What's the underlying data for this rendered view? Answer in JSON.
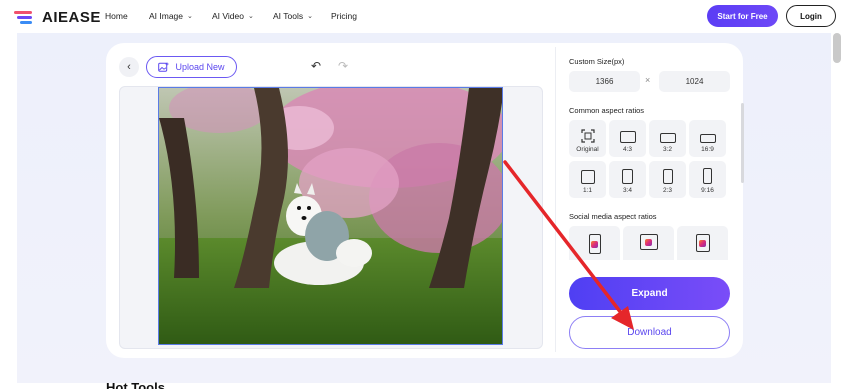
{
  "header": {
    "logo_text": "AIEASE",
    "nav": [
      {
        "label": "Home",
        "has_dropdown": false
      },
      {
        "label": "AI Image",
        "has_dropdown": true
      },
      {
        "label": "AI Video",
        "has_dropdown": true
      },
      {
        "label": "AI Tools",
        "has_dropdown": true
      },
      {
        "label": "Pricing",
        "has_dropdown": false
      }
    ],
    "start_button": "Start for Free",
    "login_button": "Login"
  },
  "editor": {
    "upload_label": "Upload New",
    "icons": {
      "back": "chevron-left-icon",
      "upload": "image-upload-icon",
      "undo": "undo-icon",
      "redo": "redo-icon"
    }
  },
  "panel": {
    "custom_size_label": "Custom Size(px)",
    "width_value": "1366",
    "height_value": "1024",
    "separator": "×",
    "common_ratios_label": "Common aspect ratios",
    "ratios": [
      {
        "label": "Original"
      },
      {
        "label": "4:3"
      },
      {
        "label": "3:2"
      },
      {
        "label": "16:9"
      },
      {
        "label": "1:1"
      },
      {
        "label": "3:4"
      },
      {
        "label": "2:3"
      },
      {
        "label": "9:16"
      }
    ],
    "social_label": "Social media aspect ratios",
    "expand_button": "Expand",
    "download_button": "Download"
  },
  "footer_peek": "Hot Tools",
  "colors": {
    "accent": "#5b3df5",
    "arrow": "#e5262a"
  }
}
